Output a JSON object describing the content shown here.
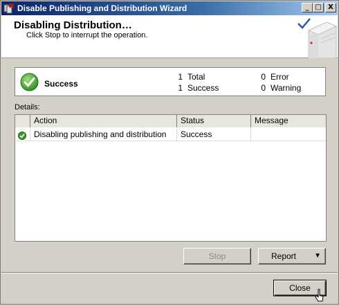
{
  "window": {
    "title": "Disable Publishing and Distribution Wizard",
    "buttons": {
      "minimize": "_",
      "maximize": "□",
      "close": "X"
    }
  },
  "header": {
    "title": "Disabling Distribution…",
    "subtitle": "Click Stop to interrupt the operation."
  },
  "summary": {
    "status_label": "Success",
    "total_count": "1",
    "total_label": "Total",
    "success_count": "1",
    "success_label": "Success",
    "error_count": "0",
    "error_label": "Error",
    "warning_count": "0",
    "warning_label": "Warning"
  },
  "details": {
    "label": "Details:",
    "columns": {
      "action": "Action",
      "status": "Status",
      "message": "Message"
    },
    "rows": [
      {
        "action": "Disabling publishing and distribution",
        "status": "Success",
        "message": ""
      }
    ]
  },
  "buttons": {
    "stop": "Stop",
    "report": "Report",
    "report_arrow": "▼",
    "close": "Close"
  },
  "colors": {
    "success_green": "#3a9a2a",
    "titlebar_start": "#0a246a",
    "titlebar_end": "#a6caf0"
  }
}
